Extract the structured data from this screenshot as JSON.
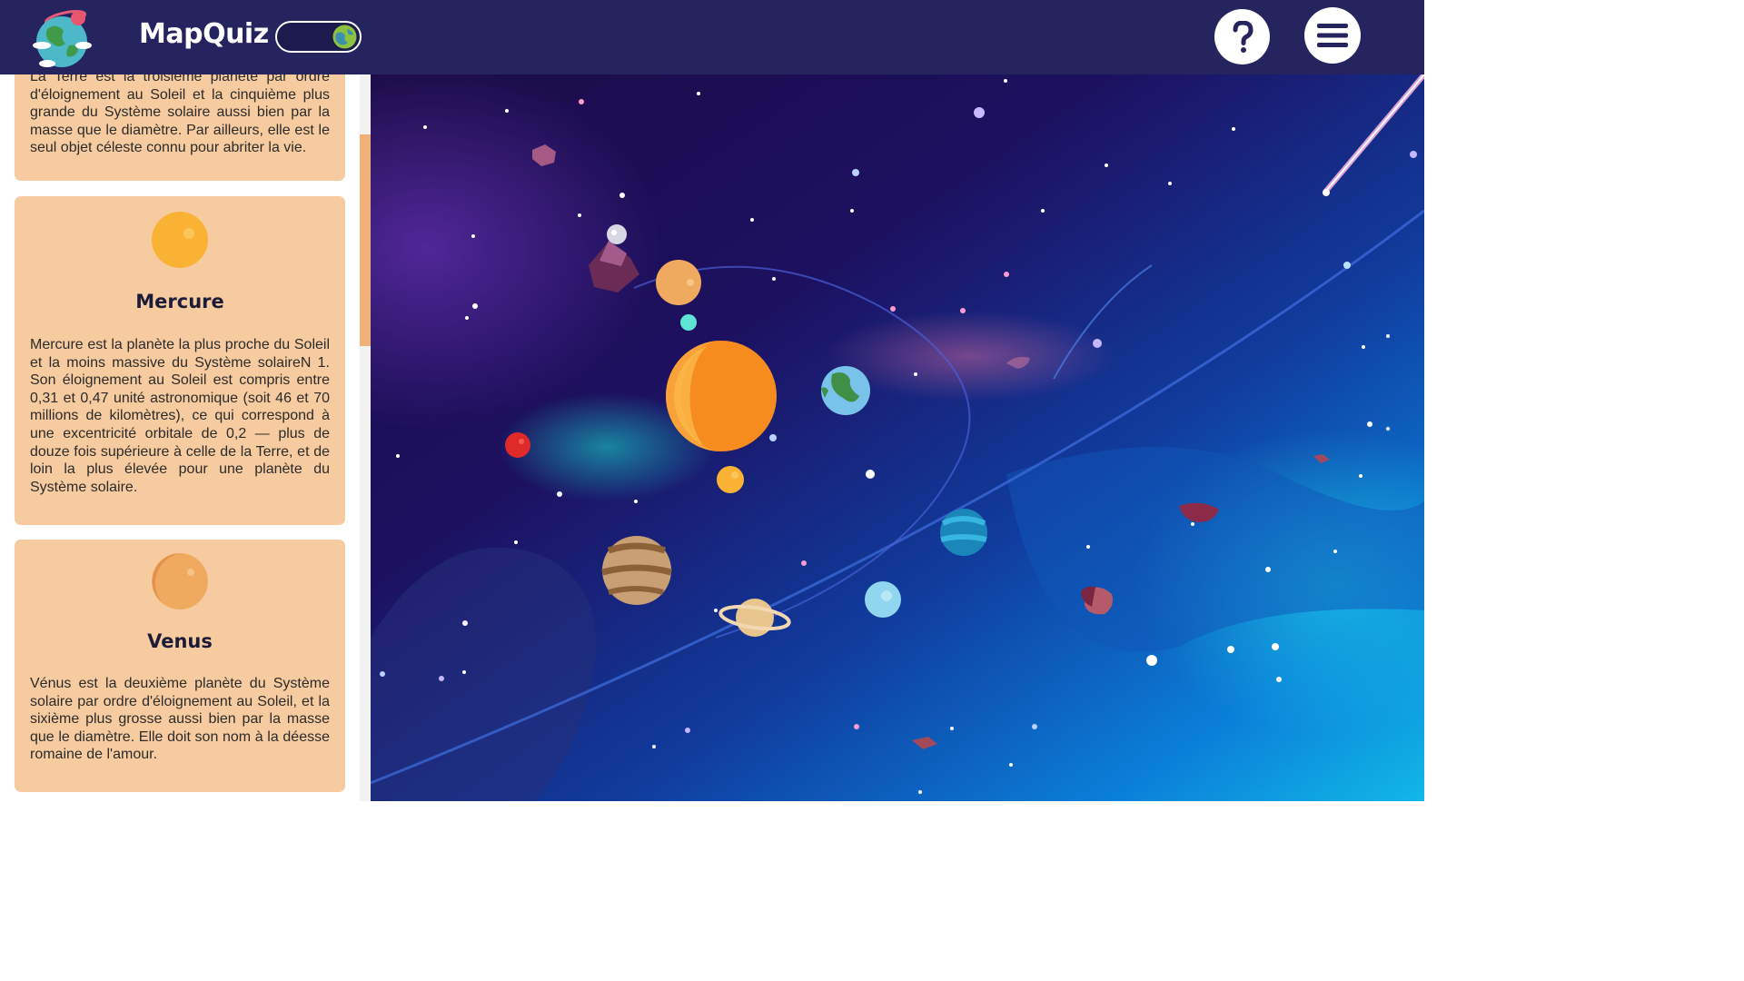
{
  "header": {
    "brand": "MapQuiz",
    "logo_icon": "earth-logo-icon",
    "toggle_icon": "globe-icon",
    "help_icon": "question-mark-icon",
    "menu_icon": "hamburger-menu-icon",
    "bg_color": "#26245e"
  },
  "panel": {
    "card_color": "#f7cba0",
    "cards": [
      {
        "text": "La Terre est la troisième planète par ordre d'éloignement au Soleil et la cinquième plus grande du Système solaire aussi bien par la masse que le diamètre. Par ailleurs, elle est le seul objet céleste connu pour abriter la vie."
      },
      {
        "title": "Mercure",
        "icon": "mercury-icon",
        "text": "Mercure est la planète la plus proche du Soleil et la moins massive du Système solaireN 1. Son éloignement au Soleil est compris entre 0,31 et 0,47 unité astronomique (soit 46 et 70 millions de kilomètres), ce qui correspond à une excentricité orbitale de 0,2 — plus de douze fois supérieure à celle de la Terre, et de loin la plus élevée pour une planète du Système solaire."
      },
      {
        "title": "Venus",
        "icon": "venus-icon",
        "text": "Vénus est la deuxième planète du Système solaire par ordre d'éloignement au Soleil, et la sixième plus grosse aussi bien par la masse que le diamètre. Elle doit son nom à la déesse romaine de l'amour."
      }
    ]
  },
  "scene": {
    "planets": [
      "sun",
      "mercury",
      "venus",
      "earth",
      "mars",
      "jupiter",
      "saturn",
      "uranus",
      "neptune",
      "moon"
    ],
    "colors": {
      "sun": "#f68c1e",
      "space_dark": "#1a0d4a",
      "space_blue": "#0e6fd6"
    }
  }
}
